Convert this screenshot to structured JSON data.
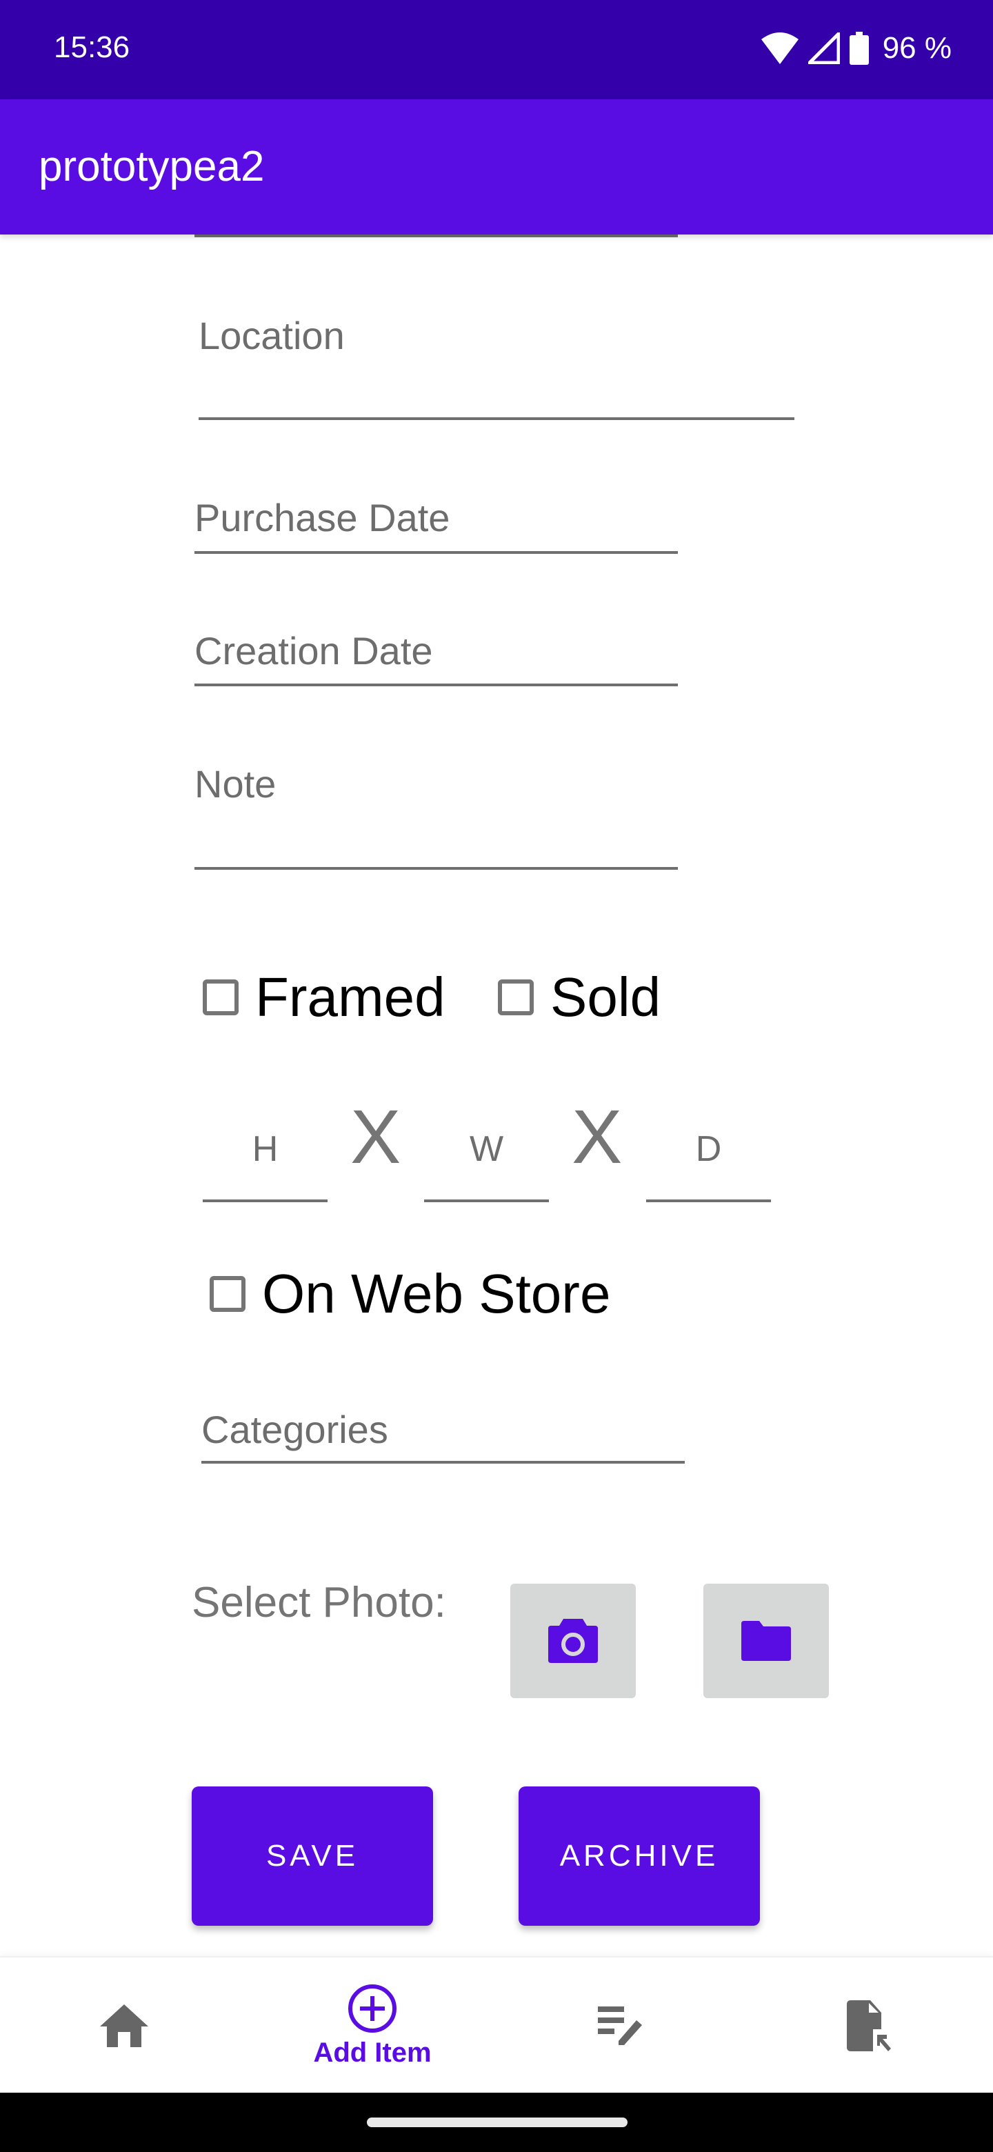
{
  "status_bar": {
    "time": "15:36",
    "battery_percent": "96 %",
    "icons": [
      "wifi-icon",
      "signal-icon",
      "battery-icon"
    ]
  },
  "app_bar": {
    "title": "prototypea2"
  },
  "form": {
    "fields": {
      "location": {
        "placeholder": "Location",
        "value": ""
      },
      "purchase_date": {
        "placeholder": "Purchase Date",
        "value": ""
      },
      "creation_date": {
        "placeholder": "Creation Date",
        "value": ""
      },
      "note": {
        "placeholder": "Note",
        "value": ""
      },
      "categories": {
        "placeholder": "Categories",
        "value": ""
      }
    },
    "checkboxes": {
      "framed": {
        "label": "Framed",
        "checked": false
      },
      "sold": {
        "label": "Sold",
        "checked": false
      },
      "on_web_store": {
        "label": "On Web Store",
        "checked": false
      }
    },
    "dimensions": {
      "height_placeholder": "H",
      "width_placeholder": "W",
      "depth_placeholder": "D",
      "separator": "X"
    },
    "photo": {
      "label": "Select Photo:",
      "camera_icon": "camera-icon",
      "folder_icon": "folder-icon"
    },
    "buttons": {
      "save": "SAVE",
      "archive": "ARCHIVE"
    }
  },
  "bottom_nav": {
    "items": [
      {
        "icon": "home-icon",
        "label": "",
        "active": false
      },
      {
        "icon": "add-circle-icon",
        "label": "Add Item",
        "active": true
      },
      {
        "icon": "edit-list-icon",
        "label": "",
        "active": false
      },
      {
        "icon": "file-export-icon",
        "label": "",
        "active": false
      }
    ]
  },
  "colors": {
    "primary": "#5a0de3",
    "primary_dark": "#3300aa",
    "hint_text": "#6d6d6d",
    "icon_inactive": "#666666",
    "photo_button_bg": "#d6d7d7"
  }
}
